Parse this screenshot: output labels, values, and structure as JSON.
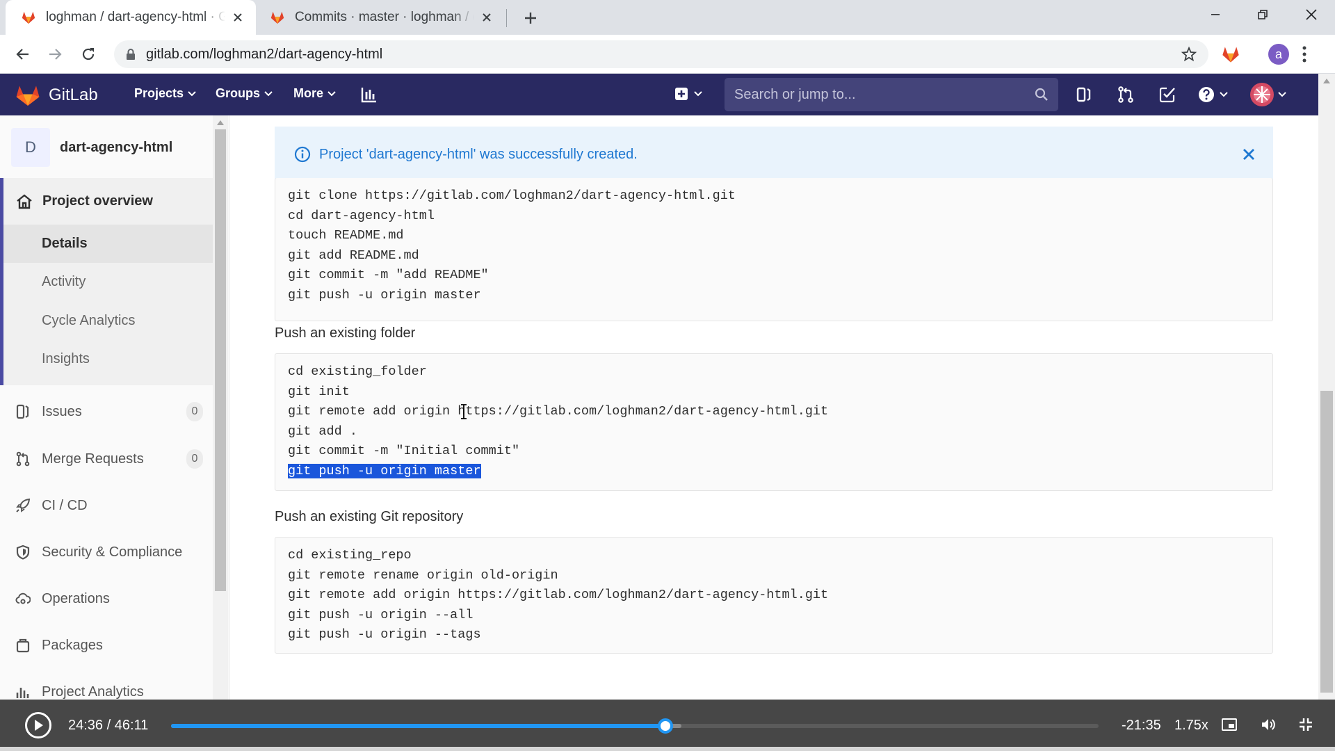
{
  "browser": {
    "tabs": [
      {
        "title": "loghman / dart-agency-html · GitLab",
        "active": true
      },
      {
        "title": "Commits · master · loghman / dart-agency-html",
        "active": false
      }
    ],
    "url": "gitlab.com/loghman2/dart-agency-html",
    "profile_initial": "a"
  },
  "gitlab_nav": {
    "brand": "GitLab",
    "menus": [
      "Projects",
      "Groups",
      "More"
    ],
    "search_placeholder": "Search or jump to..."
  },
  "sidebar": {
    "project_initial": "D",
    "project_name": "dart-agency-html",
    "overview": {
      "label": "Project overview",
      "items": [
        "Details",
        "Activity",
        "Cycle Analytics",
        "Insights"
      ],
      "selected": "Details"
    },
    "items": [
      {
        "label": "Issues",
        "icon": "issues-icon",
        "badge": "0"
      },
      {
        "label": "Merge Requests",
        "icon": "merge-request-icon",
        "badge": "0"
      },
      {
        "label": "CI / CD",
        "icon": "rocket-icon"
      },
      {
        "label": "Security & Compliance",
        "icon": "shield-icon"
      },
      {
        "label": "Operations",
        "icon": "cloud-gear-icon"
      },
      {
        "label": "Packages",
        "icon": "package-icon"
      },
      {
        "label": "Project Analytics",
        "icon": "analytics-icon"
      }
    ]
  },
  "flash": {
    "message": "Project 'dart-agency-html' was successfully created."
  },
  "code_blocks": {
    "new_repo": [
      "git clone https://gitlab.com/loghman2/dart-agency-html.git",
      "cd dart-agency-html",
      "touch README.md",
      "git add README.md",
      "git commit -m \"add README\"",
      "git push -u origin master"
    ],
    "existing_folder": {
      "heading": "Push an existing folder",
      "lines": [
        "cd existing_folder",
        "git init",
        "git remote add origin https://gitlab.com/loghman2/dart-agency-html.git",
        "git add .",
        "git commit -m \"Initial commit\"",
        "git push -u origin master"
      ],
      "selected_line": "git push -u origin master"
    },
    "existing_repo": {
      "heading": "Push an existing Git repository",
      "lines": [
        "cd existing_repo",
        "git remote rename origin old-origin",
        "git remote add origin https://gitlab.com/loghman2/dart-agency-html.git",
        "git push -u origin --all",
        "git push -u origin --tags"
      ]
    }
  },
  "player": {
    "elapsed": "24:36",
    "duration": "46:11",
    "time_display": "24:36 / 46:11",
    "remaining": "-21:35",
    "speed": "1.75x",
    "progress_fraction": 0.5327,
    "buffered_fraction": 0.55
  },
  "colors": {
    "gitlab_nav": "#292961",
    "accent_blue": "#1f78d1",
    "player_progress": "#2196f3",
    "selection": "#1a56db"
  }
}
